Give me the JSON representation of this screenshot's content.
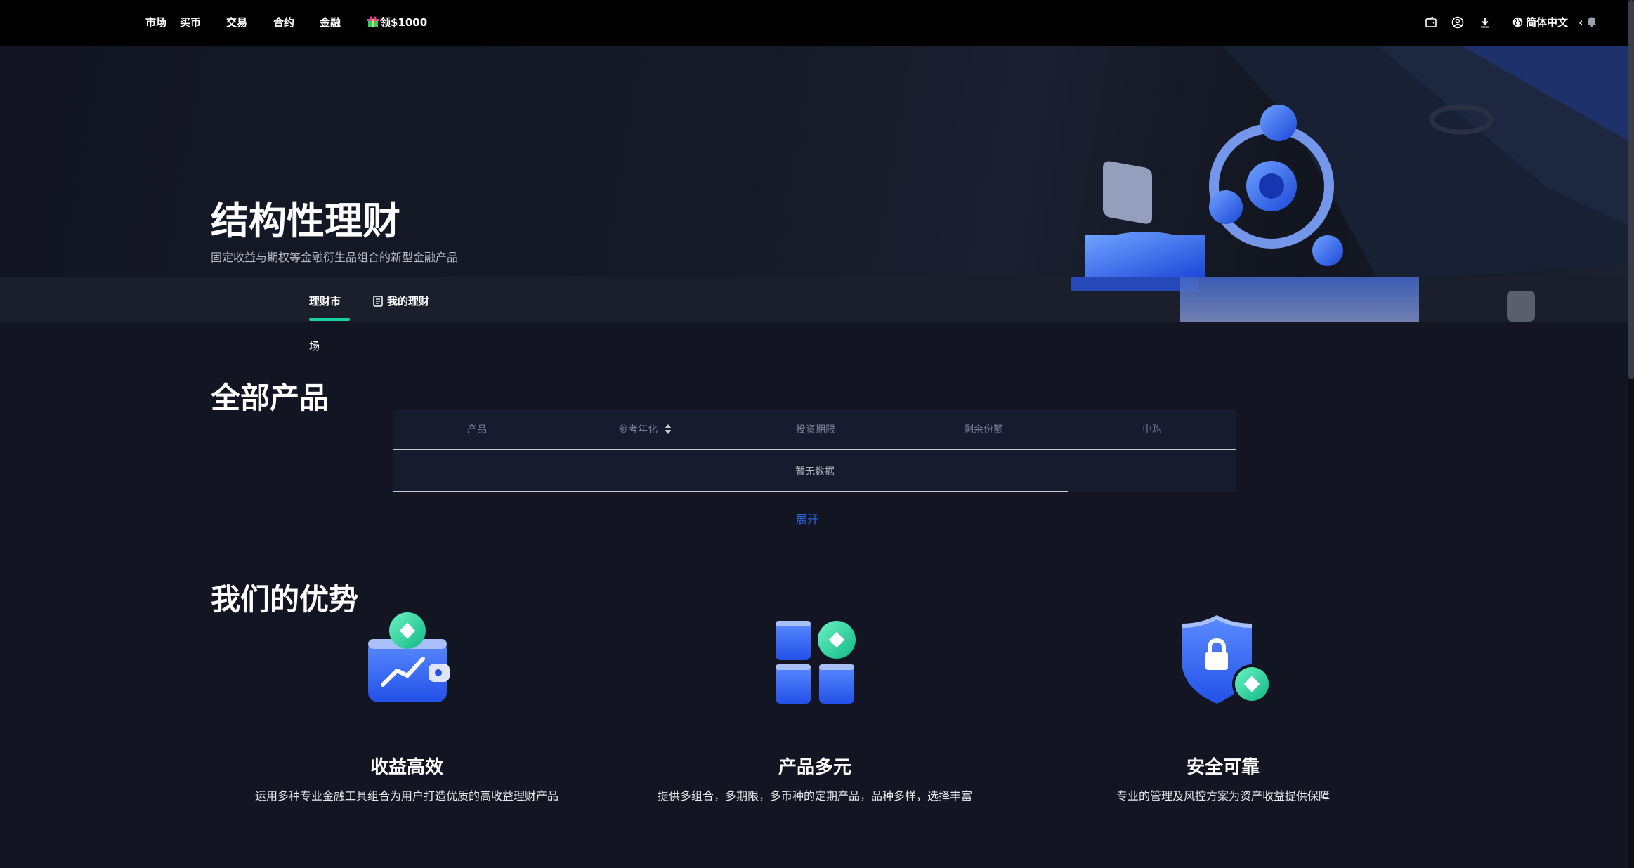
{
  "nav": {
    "items": [
      "市场",
      "买币",
      "交易",
      "合约",
      "金融"
    ],
    "promo": "领$1000",
    "language": "简体中文",
    "language_caret": "‹"
  },
  "hero": {
    "title": "结构性理财",
    "subtitle": "固定收益与期权等金融衍生品组合的新型金融产品"
  },
  "tabs": {
    "market": "理财市",
    "market_wrap": "场",
    "mine": "我的理财"
  },
  "products": {
    "title": "全部产品",
    "columns": [
      "产品",
      "参考年化",
      "投资期限",
      "剩余份额",
      "申购"
    ],
    "empty": "暂无数据",
    "expand": "展开"
  },
  "advantages": {
    "title": "我们的优势",
    "items": [
      {
        "title": "收益高效",
        "desc": "运用多种专业金融工具组合为用户打造优质的高收益理财产品",
        "icon": "wallet-coin-icon"
      },
      {
        "title": "产品多元",
        "desc": "提供多组合，多期限，多币种的定期产品，品种多样，选择丰富",
        "icon": "grid-coin-icon"
      },
      {
        "title": "安全可靠",
        "desc": "专业的管理及风控方案为资产收益提供保障",
        "icon": "shield-lock-icon"
      }
    ]
  },
  "colors": {
    "accent": "#19d2a0",
    "link": "#2b63d9",
    "background": "#131622"
  }
}
